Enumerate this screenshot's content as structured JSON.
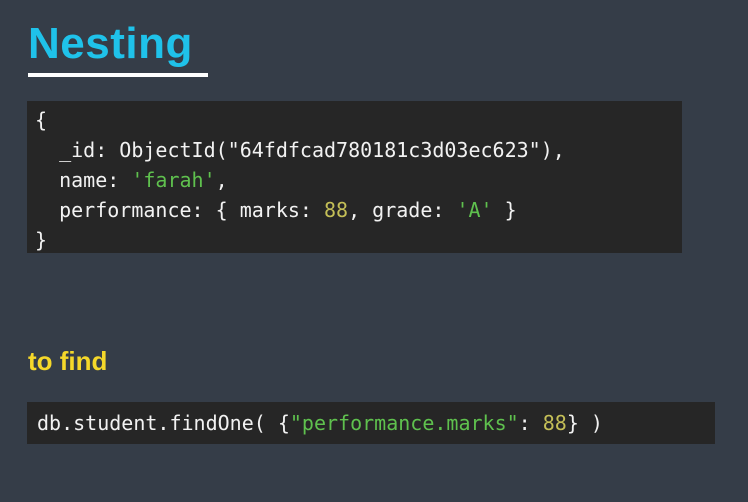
{
  "slide": {
    "title": "Nesting",
    "subtitle": "to find",
    "colors": {
      "background": "#353d48",
      "title": "#1fc2ea",
      "subtitle": "#f5d82a",
      "code_background": "#262626",
      "code_text": "#f2f2f2",
      "string": "#5fc14e",
      "number": "#c4bf57"
    }
  },
  "document_code": {
    "open_brace": "{",
    "id_line_prefix": "  _id: ObjectId(\"64fdfcad780181c3d03ec623\"),",
    "name_key": "  name: ",
    "name_value": "'farah'",
    "name_suffix": ",",
    "perf_prefix": "  performance: { marks: ",
    "marks_value": "88",
    "grade_key": ", grade: ",
    "grade_value": "'A'",
    "perf_suffix": " }",
    "close_brace": "}"
  },
  "query_code": {
    "prefix": "db.student.findOne( {",
    "key": "\"performance.marks\"",
    "colon": ": ",
    "value": "88",
    "suffix": "} )"
  }
}
